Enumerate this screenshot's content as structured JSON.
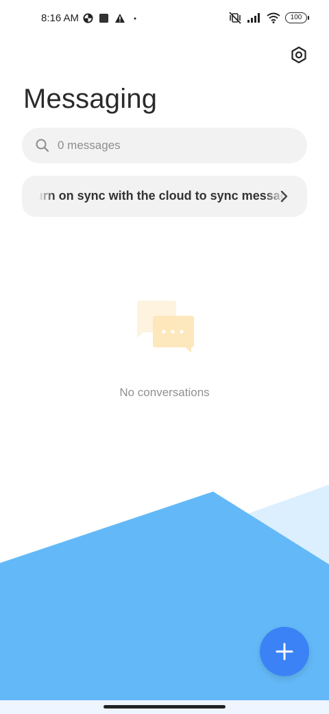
{
  "status_bar": {
    "time": "8:16 AM",
    "battery": "100",
    "left_icons": [
      "data-saver-icon",
      "square-notification-icon",
      "warning-icon",
      "dot-icon"
    ],
    "right_icons": [
      "vibrate-off-icon",
      "signal-icon",
      "wifi-icon",
      "battery-icon"
    ]
  },
  "header": {
    "title": "Messaging",
    "settings_icon": "settings-hexagon-icon"
  },
  "search": {
    "placeholder": "0 messages",
    "icon": "search-icon"
  },
  "sync_banner": {
    "text": "Turn on sync with the cloud to sync messages",
    "icon": "chevron-right-icon"
  },
  "empty_state": {
    "icon": "chat-bubbles-icon",
    "text": "No conversations"
  },
  "fab": {
    "icon": "plus-icon"
  },
  "colors": {
    "accent": "#3b82f6",
    "bg_shape_primary": "#63b9f7",
    "bg_shape_secondary": "#dcefff",
    "surface": "#f2f2f2"
  }
}
